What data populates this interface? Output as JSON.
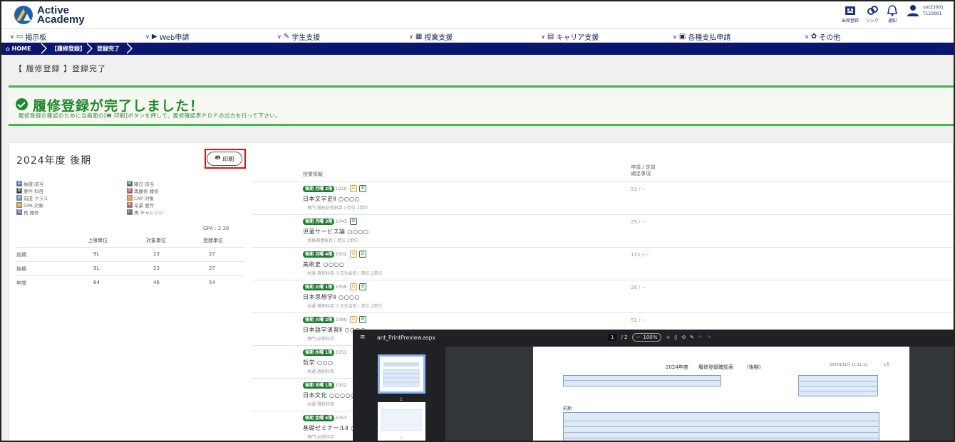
{
  "app": {
    "logo_line1": "Active",
    "logo_line2": "Academy"
  },
  "header": {
    "icons": [
      {
        "name": "出席登録",
        "icon": "attendance-icon"
      },
      {
        "name": "リンク",
        "icon": "link-icon"
      },
      {
        "name": "通知",
        "icon": "bell-icon"
      }
    ],
    "user_id1": "unt23001",
    "user_id2": "T123001"
  },
  "menu": [
    {
      "label": "掲示板",
      "icon": "board-icon"
    },
    {
      "label": "Web申請",
      "icon": "web-icon"
    },
    {
      "label": "学生支援",
      "icon": "pen-icon"
    },
    {
      "label": "授業支援",
      "icon": "class-icon"
    },
    {
      "label": "キャリア支援",
      "icon": "career-icon"
    },
    {
      "label": "各種支払申請",
      "icon": "payment-icon"
    },
    {
      "label": "その他",
      "icon": "gear-icon"
    }
  ],
  "breadcrumb": [
    "HOME",
    "【履修登録】",
    "登録完了"
  ],
  "page_title": "【 履修登録 】登録完了",
  "banner": {
    "title": "履修登録が完了しました！",
    "subtitle": "履修登録の確認のために当画面の[🖶 印刷]ボタンを押して、履修確認表ＰＤＦの出力を行って下さい。",
    "accent": "#3dbb4a"
  },
  "term": {
    "title": "2024年度 後期",
    "print_label": "印刷"
  },
  "legend": [
    {
      "label": "抽選 該当",
      "color": "#3a66c4",
      "mark": "抽"
    },
    {
      "label": "曜日 該当",
      "color": "#1f7a34",
      "mark": "曜"
    },
    {
      "label": "要件 科目",
      "color": "#333333",
      "mark": "要"
    },
    {
      "label": "再履修 履修",
      "color": "#c43a8a",
      "mark": "再"
    },
    {
      "label": "前提 クラス",
      "color": "#3a9ac4",
      "mark": "前"
    },
    {
      "label": "CAP 対象",
      "color": "#e0a020",
      "mark": "C"
    },
    {
      "label": "GPA 対象",
      "color": "#e0a020",
      "mark": "G"
    },
    {
      "label": "卒業 要件",
      "color": "#d05050",
      "mark": "卒"
    },
    {
      "label": "再 履修",
      "color": "#3a66c4",
      "mark": "再"
    },
    {
      "label": "再 チャレンジ",
      "color": "#666666",
      "mark": "ﾁｬ"
    }
  ],
  "gpa": "GPA : 2.38",
  "summary": {
    "headers": [
      "上限単位",
      "対象単位",
      "登録単位"
    ],
    "rows": [
      {
        "label": "前期",
        "values": [
          "9L",
          "23",
          "27"
        ]
      },
      {
        "label": "後期",
        "values": [
          "9L",
          "23",
          "27"
        ]
      },
      {
        "label": "年間",
        "values": [
          "64",
          "46",
          "54"
        ]
      }
    ]
  },
  "courses": {
    "header_name": "授業情報",
    "header_count1": "申請 / 定員",
    "header_count2": "補足事項",
    "rows": [
      {
        "tag": "後期 月曜 2限",
        "code": "11020",
        "badges": [
          "G",
          "B"
        ],
        "name": "日本文学史Ⅱ ○○○○",
        "sub": "専門 選択必修科目 | 単位 2単位",
        "count": "51 / --"
      },
      {
        "tag": "後期 月曜 3限",
        "code": "11043",
        "badges": [
          "B"
        ],
        "name": "児童サービス論 ○○○○",
        "sub": "資格関連科目 | 単位 2単位",
        "count": "29 / --"
      },
      {
        "tag": "後期 月曜 4限",
        "code": "11002",
        "badges": [
          "G",
          "B"
        ],
        "name": "美術史 ○○○○",
        "sub": "共通 選択科目 人文社会系 | 単位 2単位",
        "count": "115 / --"
      },
      {
        "tag": "後期 火曜 1限",
        "code": "11059",
        "badges": [
          "G",
          "B"
        ],
        "name": "日本思想学Ⅱ ○○○○",
        "sub": "共通 選択科目 人文社会系 | 単位 2単位",
        "count": "26 / --"
      },
      {
        "tag": "後期 火曜 2限",
        "code": "11080",
        "badges": [
          "G",
          "B"
        ],
        "name": "日本語学演習Ⅱ ○○○○",
        "sub": "専門 必修科目",
        "count": "51 / --"
      },
      {
        "tag": "後期 水曜 1限",
        "code": "11051",
        "badges": [],
        "name": "哲学 ○○○",
        "sub": "共通 選択科目",
        "count": ""
      },
      {
        "tag": "後期 木曜 1限",
        "code": "11052",
        "badges": [],
        "name": "日本文化 ○○○○○",
        "sub": "共通 選択科目",
        "count": ""
      },
      {
        "tag": "後期 金曜 4限",
        "code": "11053",
        "badges": [],
        "name": "基礎ゼミナールⅡ ○○○",
        "sub": "専門 必修科目",
        "count": ""
      }
    ]
  },
  "pdf": {
    "title": "ant_PrintPreview.aspx",
    "page": "1",
    "pages": "/ 2",
    "zoom": "100%",
    "thumb1": "1",
    "thumb2": "2",
    "doc_title": "2024年度",
    "doc_heading": "履修登録確認表",
    "doc_term": "(後期)",
    "doc_date": "2024年11月 11:11:11",
    "doc_page": "1頁",
    "doc_section": "前期"
  }
}
